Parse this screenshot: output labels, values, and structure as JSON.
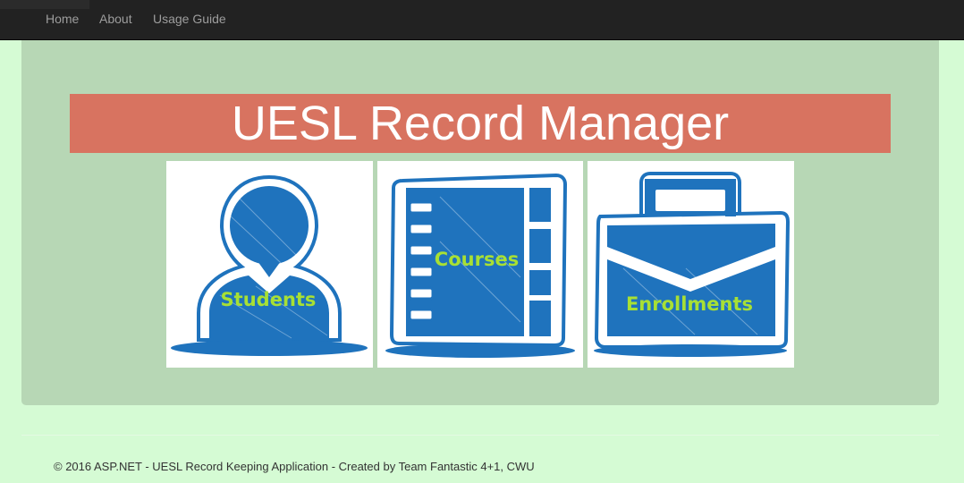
{
  "nav": {
    "items": [
      {
        "label": "Home"
      },
      {
        "label": "About"
      },
      {
        "label": "Usage Guide"
      }
    ]
  },
  "banner": {
    "title": "UESL Record Manager"
  },
  "tiles": [
    {
      "label": "Students",
      "icon": "student-icon"
    },
    {
      "label": "Courses",
      "icon": "notebook-icon"
    },
    {
      "label": "Enrollments",
      "icon": "briefcase-icon"
    }
  ],
  "footer": {
    "text": "© 2016 ASP.NET - UESL Record Keeping Application - Created by Team Fantastic 4+1, CWU"
  },
  "colors": {
    "page_bg": "#d5fbd4",
    "navbar_bg": "#222222",
    "jumbotron_bg": "#b7d7b5",
    "banner_bg": "#d87360",
    "icon_blue": "#1f73bd",
    "label_green": "#a8e034"
  }
}
